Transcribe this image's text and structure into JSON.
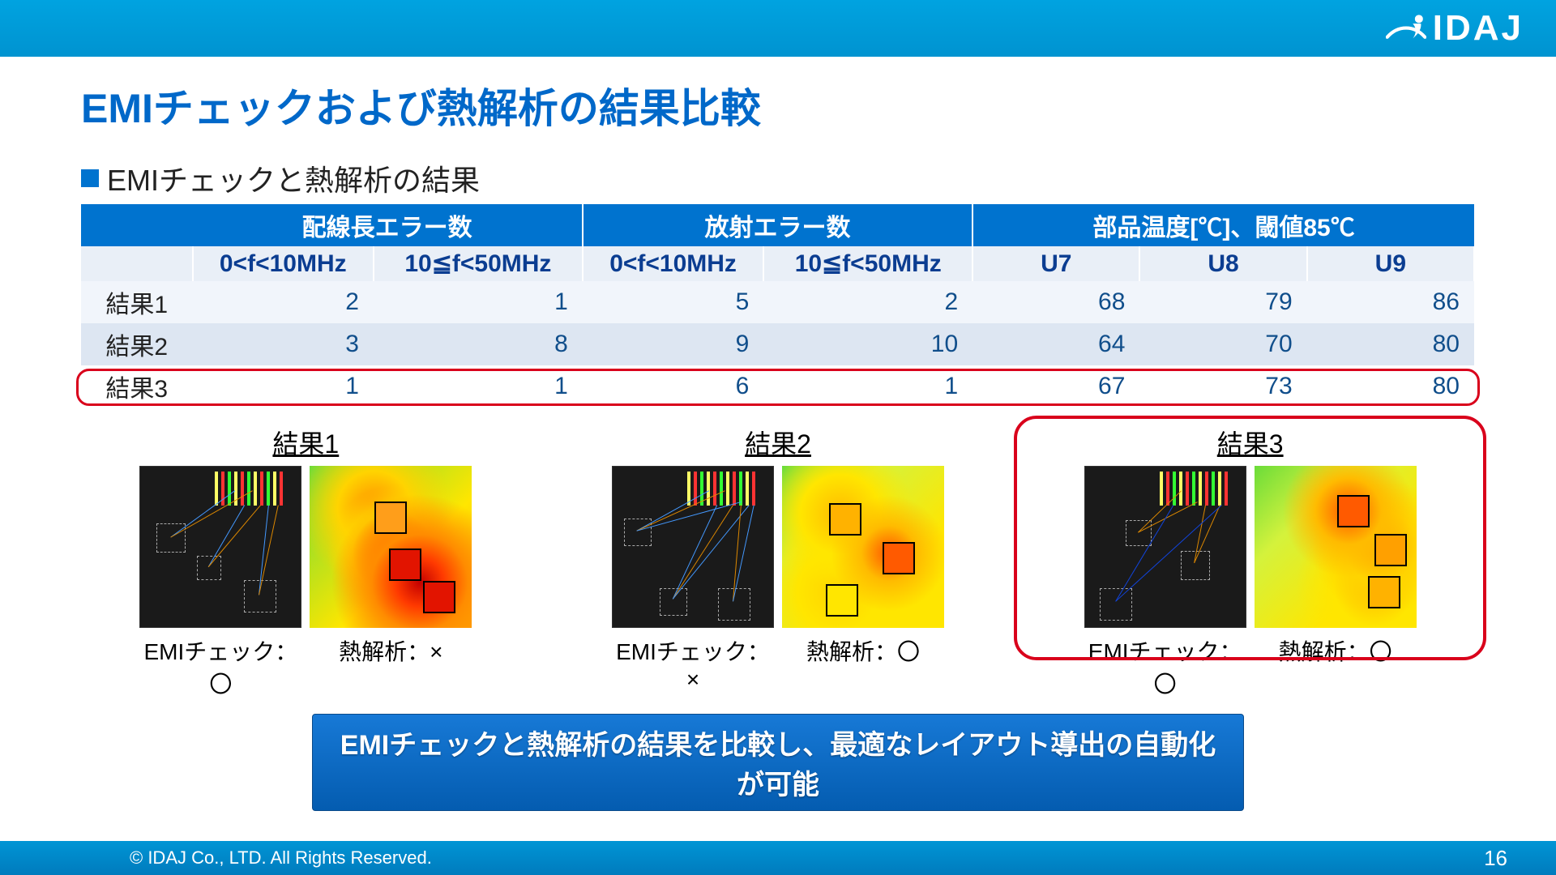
{
  "brand": "IDAJ",
  "title": "EMIチェックおよび熱解析の結果比較",
  "bullet": "EMIチェックと熱解析の結果",
  "table": {
    "group_headers": [
      "配線長エラー数",
      "放射エラー数",
      "部品温度[℃]、閾値85℃"
    ],
    "sub_headers": [
      "0<f<10MHz",
      "10≦f<50MHz",
      "0<f<10MHz",
      "10≦f<50MHz",
      "U7",
      "U8",
      "U9"
    ],
    "rows": [
      {
        "label": "結果1",
        "cells": [
          2,
          1,
          5,
          2,
          68,
          79,
          86
        ]
      },
      {
        "label": "結果2",
        "cells": [
          3,
          8,
          9,
          10,
          64,
          70,
          80
        ]
      },
      {
        "label": "結果3",
        "cells": [
          1,
          1,
          6,
          1,
          67,
          73,
          80
        ]
      }
    ]
  },
  "figures": [
    {
      "title": "結果1",
      "emi_caption": "EMIチェック：〇",
      "heat_caption": "熱解析：×",
      "highlight": false
    },
    {
      "title": "結果2",
      "emi_caption": "EMIチェック：×",
      "heat_caption": "熱解析：〇",
      "highlight": false
    },
    {
      "title": "結果3",
      "emi_caption": "EMIチェック：〇",
      "heat_caption": "熱解析：〇",
      "highlight": true
    }
  ],
  "conclusion": "EMIチェックと熱解析の結果を比較し、最適なレイアウト導出の自動化が可能",
  "copyright": "© IDAJ Co., LTD. All Rights Reserved.",
  "page_number": "16"
}
